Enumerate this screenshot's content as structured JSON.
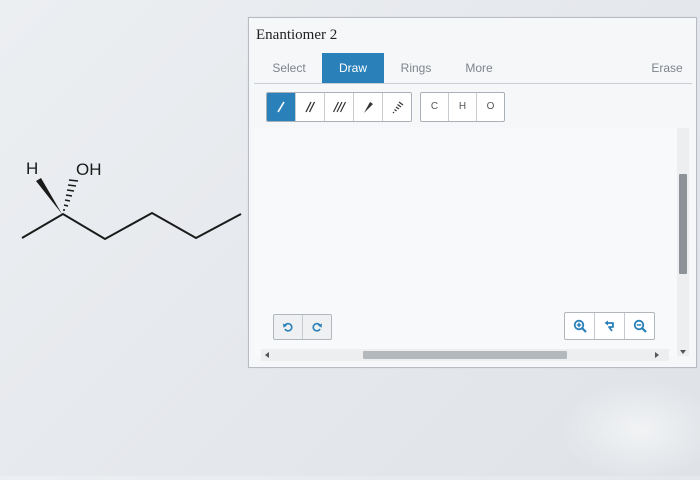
{
  "structure": {
    "label_h": "H",
    "label_oh": "OH"
  },
  "panel": {
    "title": "Enantiomer 2"
  },
  "tabs": [
    {
      "label": "Select",
      "active": false
    },
    {
      "label": "Draw",
      "active": true
    },
    {
      "label": "Rings",
      "active": false
    },
    {
      "label": "More",
      "active": false
    },
    {
      "label": "Erase",
      "active": false
    }
  ],
  "bond_tools": [
    {
      "icon": "single-bond-icon",
      "active": true
    },
    {
      "icon": "double-bond-icon",
      "active": false
    },
    {
      "icon": "triple-bond-icon",
      "active": false
    },
    {
      "icon": "wedge-bond-icon",
      "active": false
    },
    {
      "icon": "hashed-wedge-bond-icon",
      "active": false
    }
  ],
  "atoms": [
    "C",
    "H",
    "O"
  ],
  "history_tools": [
    "undo-icon",
    "redo-icon"
  ],
  "zoom_tools": [
    "zoom-in-icon",
    "reset-zoom-icon",
    "zoom-out-icon"
  ],
  "colors": {
    "accent": "#2a80b9",
    "text_muted": "#7d858c",
    "panel_bg": "#f6f7f9"
  }
}
